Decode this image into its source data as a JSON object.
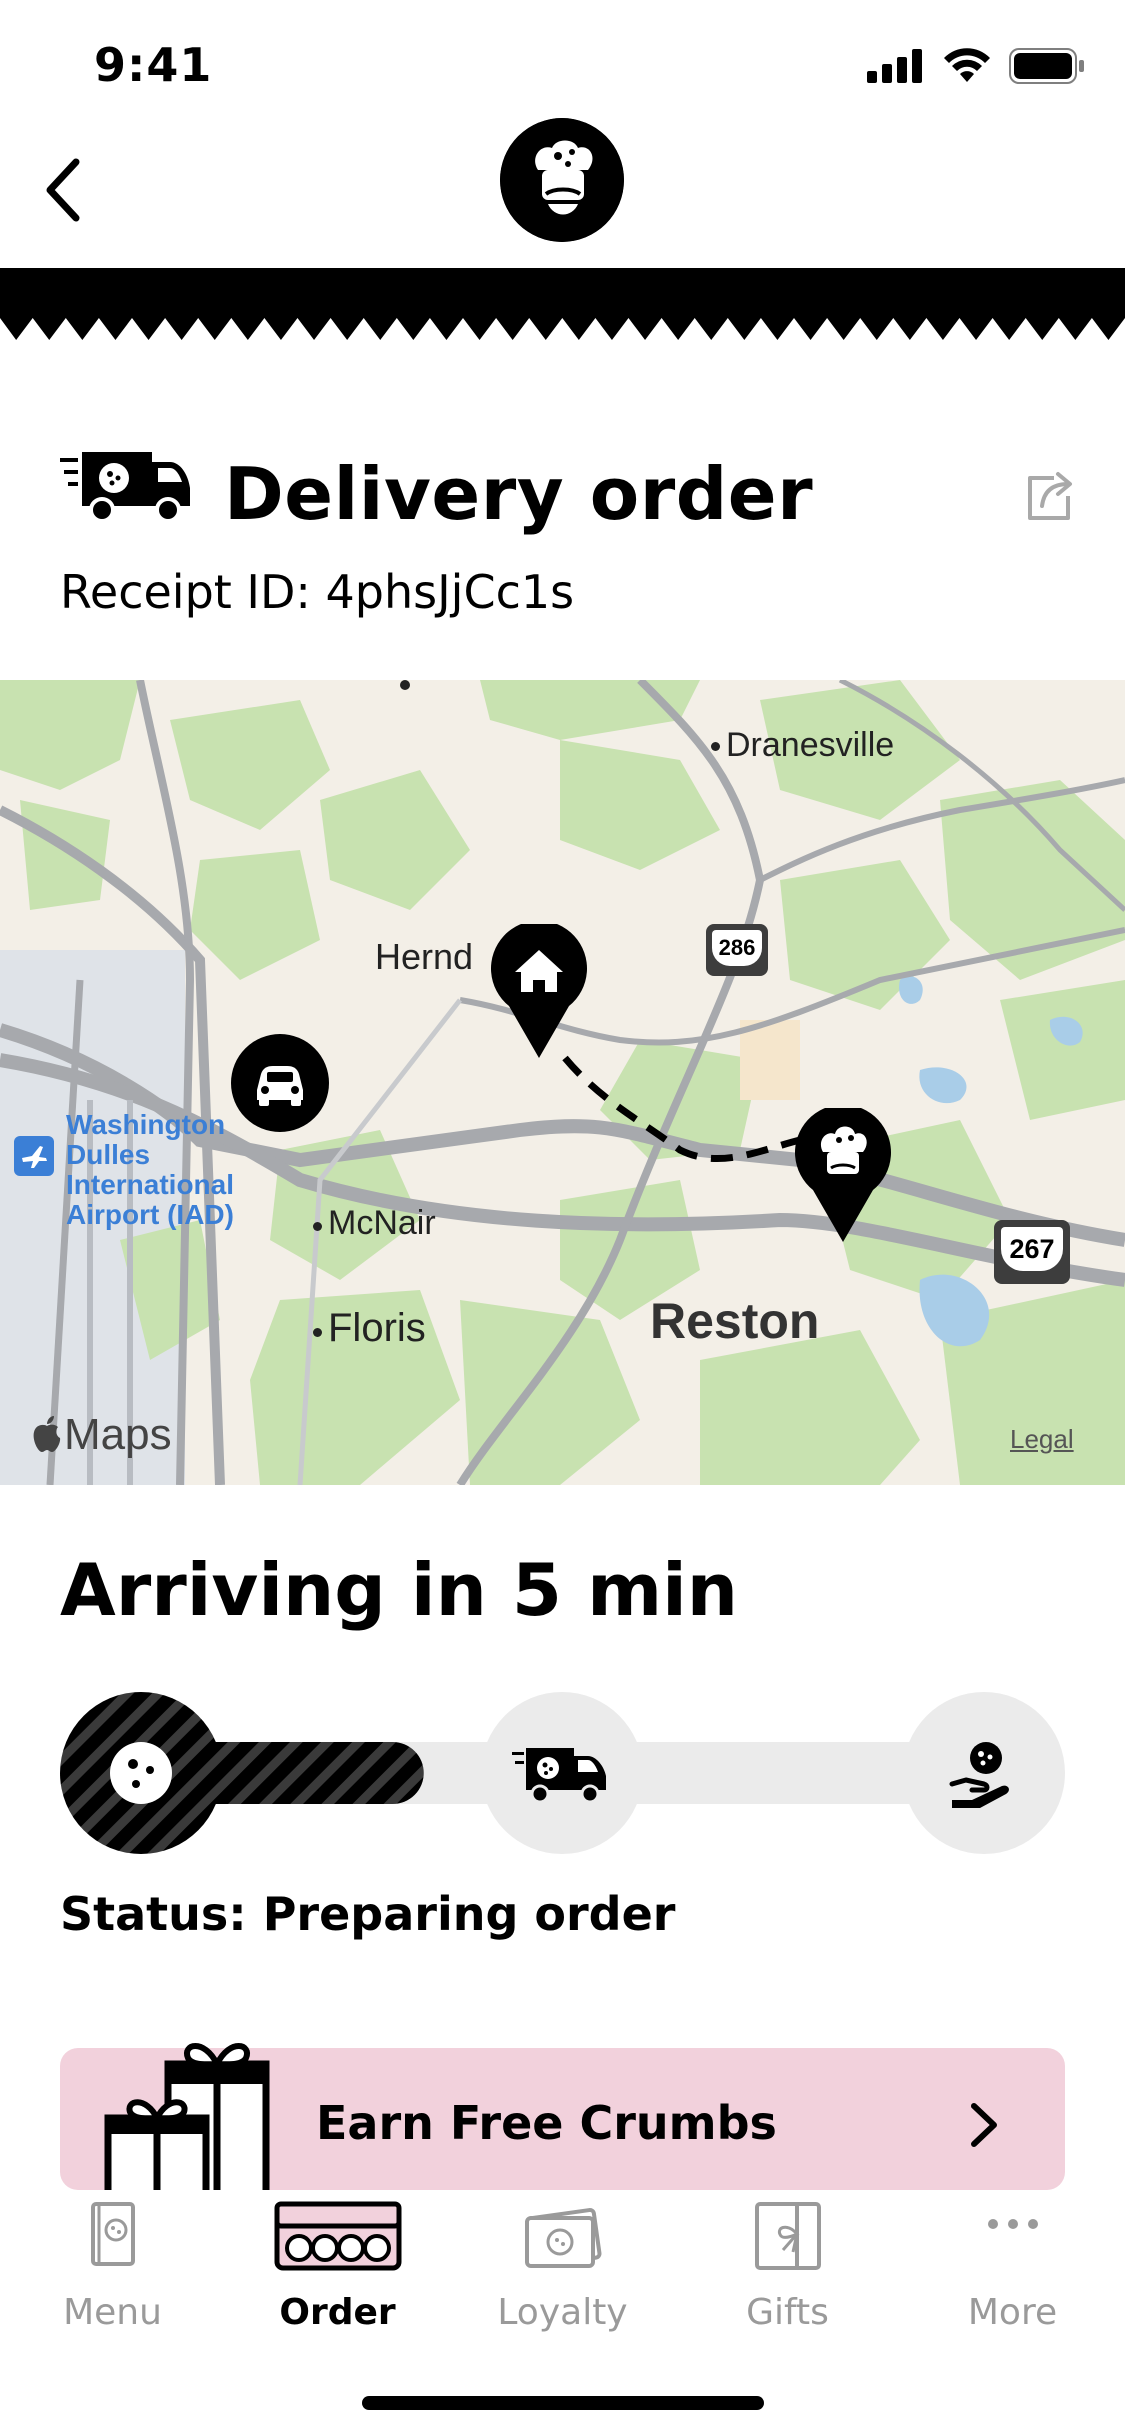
{
  "status_bar": {
    "time": "9:41"
  },
  "header": {
    "title": "Delivery order",
    "receipt": "Receipt ID: 4phsJjCc1s"
  },
  "map": {
    "labels": {
      "dranesville": "Dranesville",
      "herndon": "Hernd",
      "airport": [
        "Washington",
        "Dulles",
        "International",
        "Airport (IAD)"
      ],
      "mcnair": "McNair",
      "floris": "Floris",
      "reston": "Reston",
      "route_286": "286",
      "route_267": "267"
    },
    "attribution": "Maps",
    "legal": "Legal"
  },
  "delivery": {
    "arrival": "Arriving in 5 min",
    "status": "Status: Preparing order",
    "progress": 0.35
  },
  "promo": {
    "label": "Earn Free Crumbs"
  },
  "tabs": [
    {
      "label": "Menu",
      "icon": "menu-icon",
      "active": false
    },
    {
      "label": "Order",
      "icon": "order-box-icon",
      "active": true
    },
    {
      "label": "Loyalty",
      "icon": "loyalty-icon",
      "active": false
    },
    {
      "label": "Gifts",
      "icon": "gift-card-icon",
      "active": false
    },
    {
      "label": "More",
      "icon": "more-icon",
      "active": false
    }
  ],
  "colors": {
    "promo_bg": "#f2d1dc",
    "accent": "#000000",
    "inactive_tab": "#9a9a9a"
  }
}
